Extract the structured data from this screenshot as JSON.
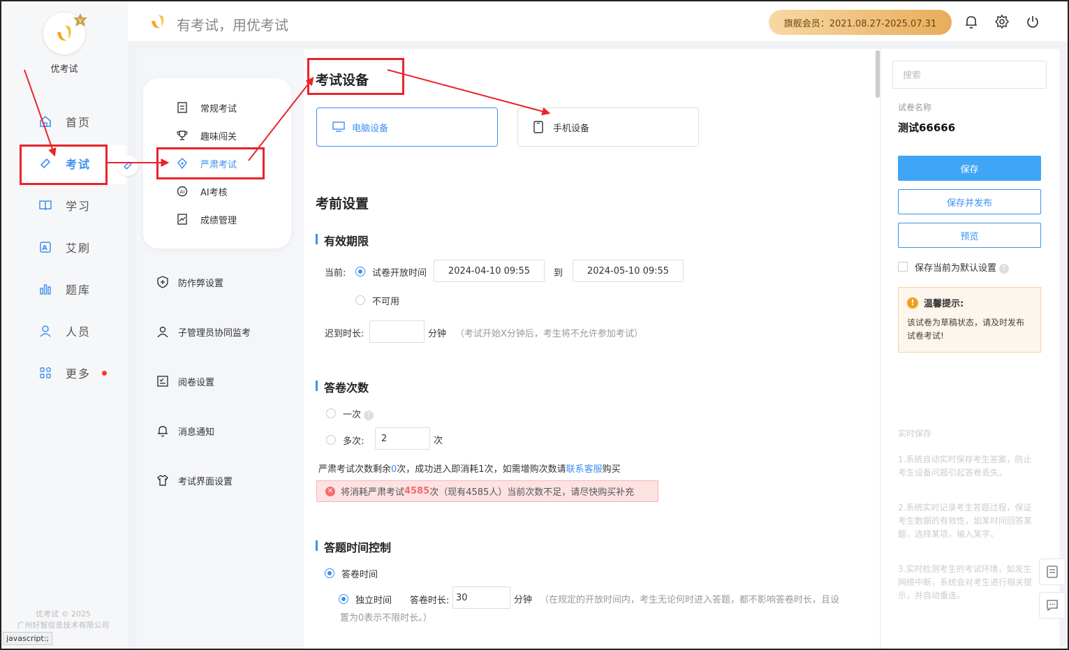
{
  "app": {
    "name": "优考试",
    "slogan": "有考试，用优考试",
    "copyright_line1": "优考试 © 2025",
    "copyright_line2": "广州好智信息技术有限公司"
  },
  "status_bar": "javascript:;",
  "header": {
    "member": "旗舰会员：2021.08.27-2025.07.31"
  },
  "nav": [
    {
      "label": "首页",
      "icon": "home-icon"
    },
    {
      "label": "考试",
      "icon": "exam-tag-icon",
      "active": true
    },
    {
      "label": "学习",
      "icon": "book-icon"
    },
    {
      "label": "艾刷",
      "icon": "a-box-icon"
    },
    {
      "label": "题库",
      "icon": "bar-chart-icon"
    },
    {
      "label": "人员",
      "icon": "user-icon"
    },
    {
      "label": "更多",
      "icon": "apps-icon",
      "badge": true
    }
  ],
  "submenu": [
    {
      "label": "常规考试",
      "icon": "document-icon"
    },
    {
      "label": "趣味闯关",
      "icon": "trophy-icon"
    },
    {
      "label": "严肃考试",
      "icon": "pen-nib-icon",
      "active": true
    },
    {
      "label": "AI考核",
      "icon": "ai-icon"
    },
    {
      "label": "成绩管理",
      "icon": "chart-doc-icon"
    }
  ],
  "settings_menu": [
    {
      "label": "防作弊设置",
      "icon": "shield-icon"
    },
    {
      "label": "子管理员协同监考",
      "icon": "user-group-icon"
    },
    {
      "label": "阅卷设置",
      "icon": "grading-icon"
    },
    {
      "label": "消息通知",
      "icon": "bell-icon"
    },
    {
      "label": "考试界面设置",
      "icon": "shirt-icon"
    }
  ],
  "main": {
    "device_title": "考试设备",
    "devices": [
      {
        "label": "电脑设备",
        "icon": "monitor-icon",
        "active": true
      },
      {
        "label": "手机设备",
        "icon": "phone-icon",
        "active": false
      }
    ],
    "pre_title": "考前设置",
    "validity": {
      "title": "有效期限",
      "current_label": "当前:",
      "option_open": "试卷开放时间",
      "start": "2024-04-10 09:55",
      "to": "到",
      "end": "2024-05-10 09:55",
      "option_unavailable": "不可用",
      "late_label": "迟到时长:",
      "late_value": "",
      "minutes": "分钟",
      "late_hint": "（考试开始X分钟后，考生将不允许参加考试）"
    },
    "attempts": {
      "title": "答卷次数",
      "once": "一次",
      "multi": "多次:",
      "multi_value": "2",
      "unit": "次",
      "remain_pre": "严肃考试次数剩余",
      "remain_count": "0",
      "remain_post": "次，成功进入即消耗1次，如需增购次数请",
      "contact": "联系客服",
      "buy": "购买",
      "err_pre": "将消耗严肃考试",
      "err_count": "4585",
      "err_post": "次（现有4585人）当前次数不足，请尽快购买补充"
    },
    "time_control": {
      "title": "答题时间控制",
      "answer_time": "答卷时间",
      "independent": "独立时间",
      "duration_label": "答卷时长:",
      "duration_value": "30",
      "minutes": "分钟",
      "hint1": "（在规定的开放时间内，考生无论何时进入答题，都不影响答卷时长，且设",
      "hint2": "置为0表示不限时长。）"
    }
  },
  "right": {
    "search_placeholder": "搜索",
    "paper_label": "试卷名称",
    "paper_name": "测试66666",
    "save": "保存",
    "save_publish": "保存并发布",
    "preview": "预览",
    "default_setting": "保存当前为默认设置",
    "tip_title": "温馨提示:",
    "tip_text": "该试卷为草稿状态，请及时发布试卷考试!",
    "realtime_title": "实时保存",
    "realtime_1": "1.系统自动实时保存考生答案，防止考生设备问题引起答卷丢失。",
    "realtime_2": "2.系统实时记录考生答题过程，保证考生数据的有效性，如某时间回答某题，选择某项，输入某字。",
    "realtime_3": "3.实时检测考生的考试环境，如发生网络中断，系统会对考生进行相关提示，并自动重连。"
  },
  "colors": {
    "accent": "#3d8ff0",
    "annotation": "#e8242a",
    "warning": "#f0a020",
    "error": "#f56c6c"
  }
}
